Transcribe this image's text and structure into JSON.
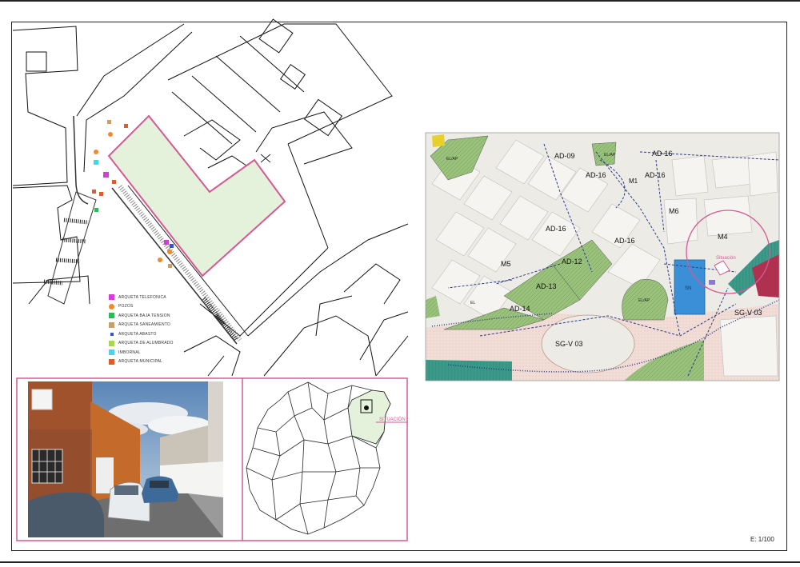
{
  "legend": {
    "items": [
      {
        "label": "ARQUETA TELEFONICA",
        "color": "#d63cd6"
      },
      {
        "label": "POZOS",
        "color": "#f08a2a"
      },
      {
        "label": "ARQUETA BAJA TENSION",
        "color": "#2fb85a"
      },
      {
        "label": "ARQUETA SANEAMIENTO",
        "color": "#c6a06a"
      },
      {
        "label": "ARQUETA ABASTO",
        "color": "#3a52d0"
      },
      {
        "label": "ARQUETA DE ALUMBRADO",
        "color": "#a8d84a"
      },
      {
        "label": "IMBORNAL",
        "color": "#4ad6e0"
      },
      {
        "label": "ARQUETA MUNICIPAL",
        "color": "#e05a2a"
      }
    ]
  },
  "zoning_map": {
    "labels": {
      "ad09": "AD-09",
      "ad16a": "AD-16",
      "ad16b": "AD-16",
      "ad16c": "AD-16",
      "ad16d": "AD-16",
      "ad16e": "AD-16",
      "ad12": "AD-12",
      "ad13": "AD-13",
      "ad14": "AD-14",
      "m5": "M5",
      "m6": "M6",
      "m4": "M4",
      "m1": "M1",
      "sgv03a": "SG-V 03",
      "sgv03b": "SG-V 03",
      "situacion": "Situación",
      "elap1": "EL/AP",
      "elap2": "EL/AP",
      "elap3": "EL/AP",
      "sn": "SN",
      "el": "EL"
    }
  },
  "location_map": {
    "situacion_label": "SITUACIÓN"
  },
  "scale": "E: 1/100"
}
